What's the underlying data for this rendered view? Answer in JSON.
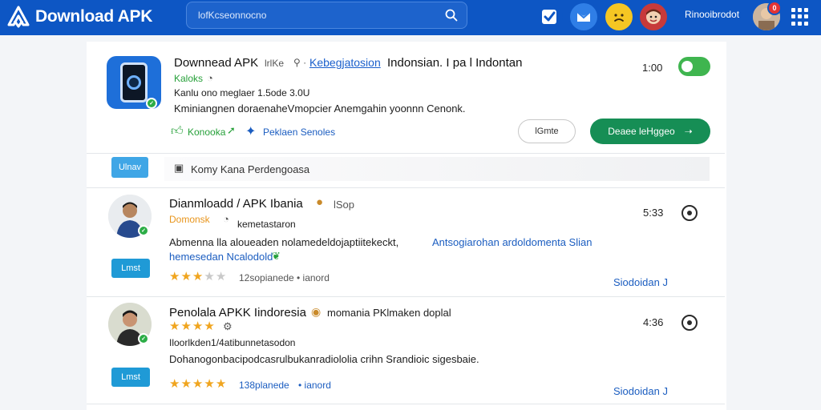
{
  "header": {
    "logo_text": "Download APK",
    "search_placeholder": "lofKcseonnocno",
    "user_label": "Rinooibrodot",
    "notification_count": "0",
    "brand_color": "#0d56c4"
  },
  "app": {
    "title": "Downnead APK",
    "title_meta": "lrlKe",
    "link_text": "Kebegjatosion",
    "title_tail": "Indonsian. I pa l Indontan",
    "developer": "Kaloks",
    "size_line": "Kanlu ono meglaer 1.5ode 3.0U",
    "description": "Kminiangnen doraenaheVmopcier Anemgahin yoonnn Cenonk.",
    "tag1": "Konooka",
    "tag2": "Peklaen Senoles",
    "time": "1:00",
    "btn_secondary": "lGmte",
    "btn_primary": "Deaee leHggeo",
    "primary_color": "#168e55"
  },
  "reply_bar": {
    "badge": "Ulnav",
    "text": "Komy Kana Perdengoasa"
  },
  "reviews": [
    {
      "title": "Dianmloadd / APK Ibania",
      "title_tail": "lSop",
      "username": "Domonsk",
      "sub": "kemetastaron",
      "body1": "Abmenna lla aloueaden nolamedeldojaptiitekeckt,",
      "body1_link": "Antsogiarohan ardoldomenta Slian",
      "body2": "hemesedan Ncalodold",
      "rating": 3,
      "rating_text": "12sopianede",
      "rating_sep": "• ianord",
      "time": "5:33",
      "button": "Lmst",
      "footer_link": "Siodoidan J"
    },
    {
      "title": "Penolala APKK Iindoresia",
      "title_tail": "momania PKlmaken doplal",
      "username": "",
      "sub": "Iloorlkden1/4atibunnetasodon",
      "body1": "Dohanogonbacipodcasrulbukanradiololia crihn Srandioic sigesbaie.",
      "body1_link": "",
      "body2": "",
      "rating": 4,
      "rating_text": "138planede",
      "rating_sep": "• ianord",
      "time": "4:36",
      "button": "Lmst",
      "footer_link": "Siodoidan J"
    }
  ]
}
